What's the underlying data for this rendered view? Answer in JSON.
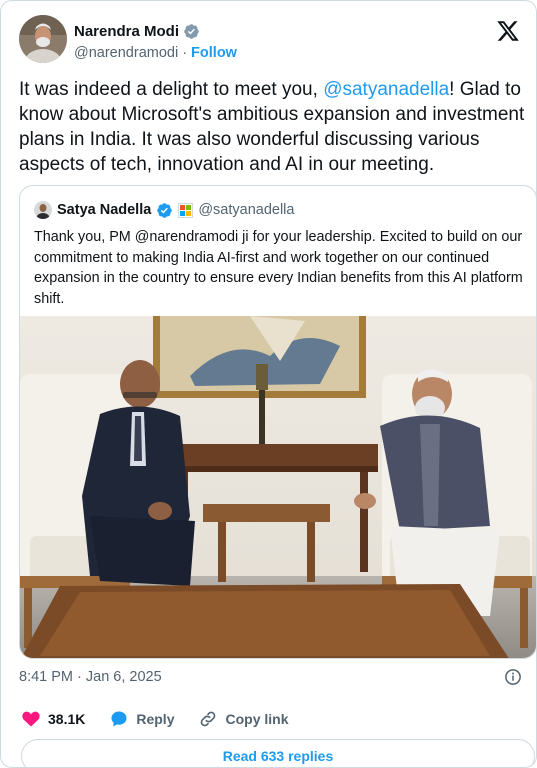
{
  "author": {
    "name": "Narendra Modi",
    "handle": "@narendramodi",
    "separator": "·",
    "follow_label": "Follow"
  },
  "tweet": {
    "text_before": "It was indeed a delight to meet you, ",
    "mention": "@satyanadella",
    "text_after": "! Glad to know about Microsoft's ambitious expansion and investment plans in India. It was also wonderful discussing various aspects of tech, innovation and AI in our meeting."
  },
  "quote": {
    "name": "Satya Nadella",
    "handle": "@satyanadella",
    "text": "Thank you, PM @narendramodi ji for your leadership. Excited to build on our commitment to making India AI-first and work together on our continued expansion in the country to ensure every Indian benefits from this AI platform shift."
  },
  "footer": {
    "timestamp": "8:41 PM · Jan 6, 2025",
    "likes": "38.1K",
    "reply_label": "Reply",
    "copy_link_label": "Copy link",
    "read_replies_label": "Read 633 replies"
  },
  "colors": {
    "accent": "#1d9bf0",
    "like": "#f91880",
    "muted": "#536471",
    "border": "#cfd9de"
  },
  "icons": [
    "verified-badge-icon",
    "x-logo-icon",
    "microsoft-badge-icon",
    "info-icon",
    "heart-icon",
    "reply-bubble-icon",
    "link-icon"
  ]
}
